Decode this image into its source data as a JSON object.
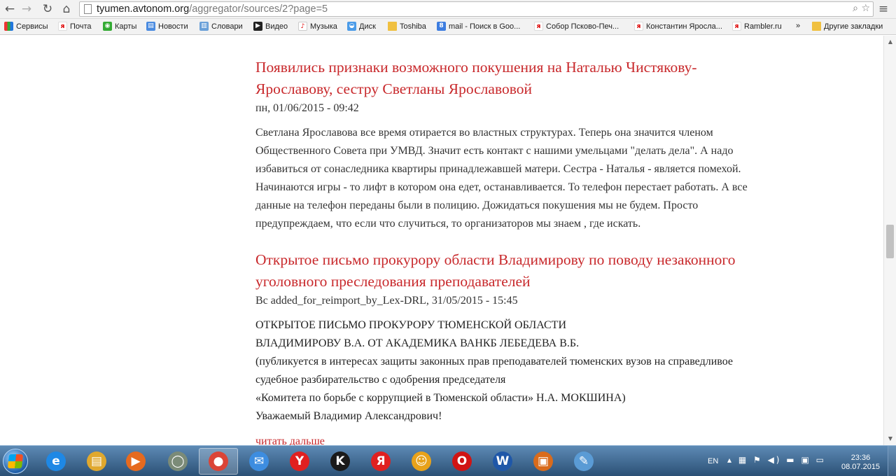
{
  "browser": {
    "url_host": "tyumen.avtonom.org",
    "url_path": "/aggregator/sources/2?page=5"
  },
  "bookmarks": [
    {
      "label": "Сервисы",
      "icon": "apps-icon"
    },
    {
      "label": "Почта",
      "icon": "yandex-mail-icon"
    },
    {
      "label": "Карты",
      "icon": "maps-icon"
    },
    {
      "label": "Новости",
      "icon": "news-icon"
    },
    {
      "label": "Словари",
      "icon": "dictionary-icon"
    },
    {
      "label": "Видео",
      "icon": "video-icon"
    },
    {
      "label": "Музыка",
      "icon": "music-icon"
    },
    {
      "label": "Диск",
      "icon": "disk-icon"
    },
    {
      "label": "Toshiba",
      "icon": "folder-icon"
    },
    {
      "label": "mail - Поиск в Goo...",
      "icon": "gmail-icon"
    },
    {
      "label": "Собор Псково-Печ...",
      "icon": "yandex-icon"
    },
    {
      "label": "Константин Яросла...",
      "icon": "yandex-icon"
    },
    {
      "label": "Rambler.ru",
      "icon": "yandex-icon"
    }
  ],
  "bookmarks_more": "»",
  "bookmarks_other": "Другие закладки",
  "articles": [
    {
      "title_line1": "Появились признаки возможного покушения на Наталью Чистякову-",
      "title_line2": "Ярославову, сестру Светланы Ярославовой",
      "meta": "пн, 01/06/2015 - 09:42",
      "body": [
        "Светлана Ярославова все время отирается во властных структурах. Теперь она значится членом",
        "Общественного Совета при УМВД. Значит есть контакт с нашими умельцами \"делать дела\". А надо",
        "избавиться от сонаследника квартиры принадлежавшей матери. Сестра - Наталья - является помехой.",
        "Начинаются игры - то лифт в котором она едет, останавливается. То телефон перестает работать. А все",
        "данные на телефон переданы были в полицию. Дожидаться покушения мы не будем. Просто",
        "предупреждаем, что если что случиться, то организаторов мы знаем , где искать."
      ]
    },
    {
      "title_line1": "Открытое письмо прокурору области Владимирову по поводу незаконного",
      "title_line2": "уголовного преследования преподавателей",
      "meta": "Вс added_for_reimport_by_Lex-DRL, 31/05/2015 - 15:45",
      "body": [
        "ОТКРЫТОЕ ПИСЬМО ПРОКУРОРУ ТЮМЕНСКОЙ ОБЛАСТИ",
        "ВЛАДИМИРОВУ В.А. ОТ АКАДЕМИКА ВАНКБ ЛЕБЕДЕВА В.Б.",
        "(публикуется в интересах защиты законных прав преподавателей тюменских вузов на справедливое",
        "судебное разбирательство с одобрения председателя",
        "«Комитета по борьбе с коррупцией в Тюменской области» Н.А. МОКШИНА)",
        "Уважаемый Владимир Александрович!"
      ],
      "read_more": "читать дальше"
    }
  ],
  "taskbar": {
    "apps": [
      {
        "name": "ie",
        "glyph": "e",
        "color": "#1e88e5"
      },
      {
        "name": "explorer",
        "glyph": "▤",
        "color": "#e0a82e"
      },
      {
        "name": "media-player",
        "glyph": "▶",
        "color": "#e66a1f"
      },
      {
        "name": "app-circle",
        "glyph": "◯",
        "color": "#7b8b78"
      },
      {
        "name": "chrome",
        "glyph": "●",
        "color": "#db4437"
      },
      {
        "name": "mail",
        "glyph": "✉",
        "color": "#3d8de0"
      },
      {
        "name": "yandex-browser",
        "glyph": "Y",
        "color": "#e02020"
      },
      {
        "name": "kaspersky",
        "glyph": "K",
        "color": "#1a1a1a"
      },
      {
        "name": "yandex",
        "glyph": "Я",
        "color": "#e02020"
      },
      {
        "name": "game",
        "glyph": "☺",
        "color": "#e8a21a"
      },
      {
        "name": "opera",
        "glyph": "O",
        "color": "#d01414"
      },
      {
        "name": "word",
        "glyph": "W",
        "color": "#1f57a8"
      },
      {
        "name": "firewall",
        "glyph": "▣",
        "color": "#d96b1c"
      },
      {
        "name": "paint",
        "glyph": "✎",
        "color": "#5a9bd5"
      }
    ],
    "language": "EN",
    "time": "23:36",
    "date": "08.07.2015"
  }
}
